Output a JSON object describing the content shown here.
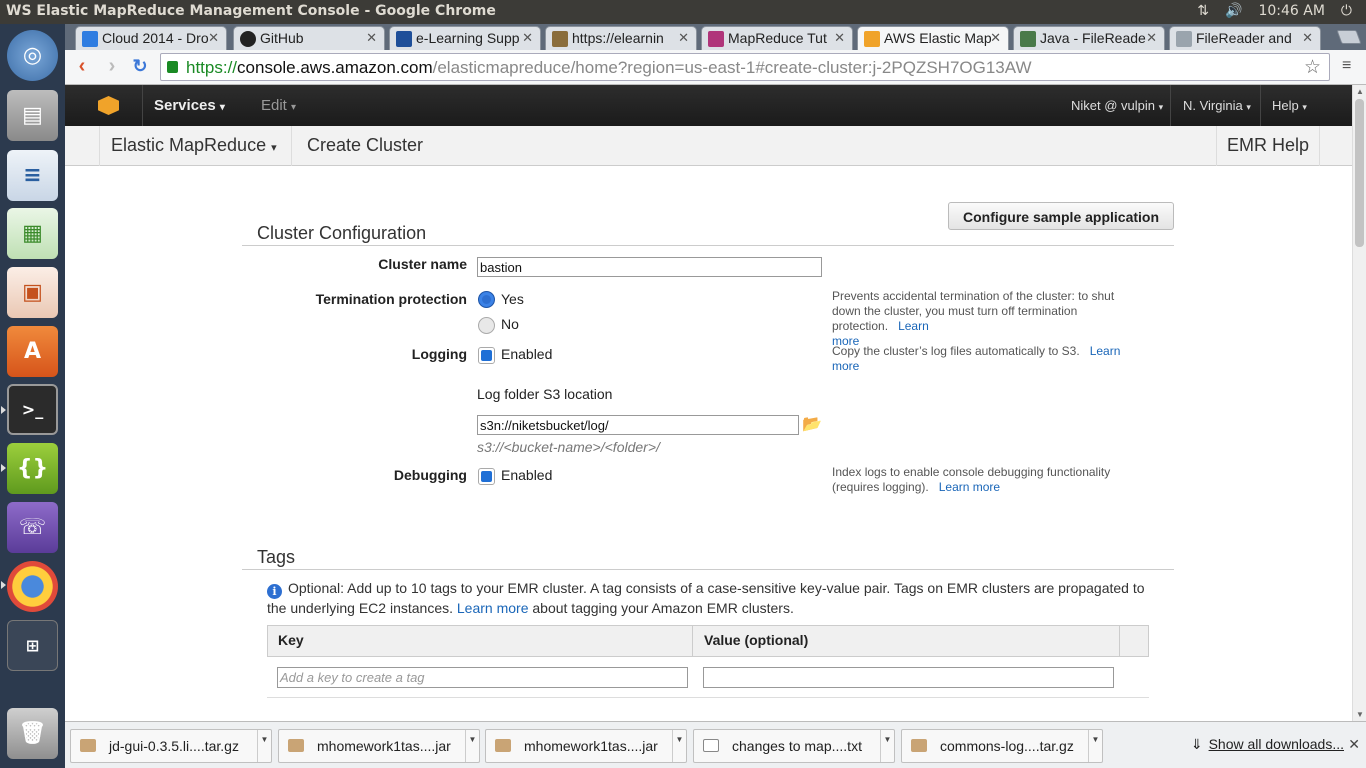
{
  "os": {
    "window_title": "WS Elastic MapReduce Management Console - Google Chrome",
    "clock": "10:46 AM"
  },
  "tabs": [
    {
      "label": "Cloud 2014 - Dro",
      "icon_color": "#2f7de1"
    },
    {
      "label": "GitHub",
      "icon_color": "#222222"
    },
    {
      "label": "e-Learning Supp",
      "icon_color": "#1f4f99"
    },
    {
      "label": "https://elearnin",
      "icon_color": "#8a6d3b"
    },
    {
      "label": "MapReduce Tut",
      "icon_color": "#b0357a"
    },
    {
      "label": "AWS Elastic Map",
      "icon_color": "#f0a32a"
    },
    {
      "label": "Java - FileReade",
      "icon_color": "#4a7a4a"
    },
    {
      "label": "FileReader and",
      "icon_color": "#9aa4ad"
    }
  ],
  "address": {
    "scheme": "https://",
    "host": "console.aws.amazon.com",
    "path": "/elasticmapreduce/home?region=us-east-1#create-cluster:j-2PQZSH7OG13AW"
  },
  "awsnav": {
    "services": "Services",
    "edit": "Edit",
    "user": "Niket @ vulpin",
    "region": "N. Virginia",
    "help": "Help"
  },
  "subnav": {
    "service": "Elastic MapReduce",
    "page": "Create Cluster",
    "help": "EMR Help"
  },
  "cluster_config": {
    "configure_sample_button": "Configure sample application",
    "title": "Cluster Configuration",
    "cluster_name_label": "Cluster name",
    "cluster_name_value": "bastion",
    "termination_label": "Termination protection",
    "termination_yes": "Yes",
    "termination_no": "No",
    "termination_help": "Prevents accidental termination of the cluster: to shut down the cluster, you must turn off termination protection.",
    "learn": "Learn",
    "more": "more",
    "logging_label": "Logging",
    "logging_enabled": "Enabled",
    "logging_help": "Copy the cluster’s log files automatically to S3.",
    "log_folder_label": "Log folder S3 location",
    "log_folder_value": "s3n://niketsbucket/log/",
    "log_folder_hint": "s3://<bucket-name>/<folder>/",
    "debugging_label": "Debugging",
    "debugging_enabled": "Enabled",
    "debugging_help": "Index logs to enable console debugging functionality (requires logging).",
    "learn_more": "Learn more"
  },
  "tags": {
    "title": "Tags",
    "info_before": "Optional: Add up to 10 tags to your EMR cluster. A tag consists of a case-sensitive key-value pair. Tags on EMR clusters are propagated to the underlying EC2 instances.",
    "info_link": "Learn more",
    "info_after": "about tagging your Amazon EMR clusters.",
    "col_key": "Key",
    "col_value": "Value (optional)",
    "key_placeholder": "Add a key to create a tag",
    "value_value": ""
  },
  "downloads": {
    "items": [
      {
        "name": "jd-gui-0.3.5.li....tar.gz"
      },
      {
        "name": "mhomework1tas....jar"
      },
      {
        "name": "mhomework1tas....jar"
      },
      {
        "name": "changes to map....txt"
      },
      {
        "name": "commons-log....tar.gz"
      }
    ],
    "show_all": "Show all downloads..."
  }
}
